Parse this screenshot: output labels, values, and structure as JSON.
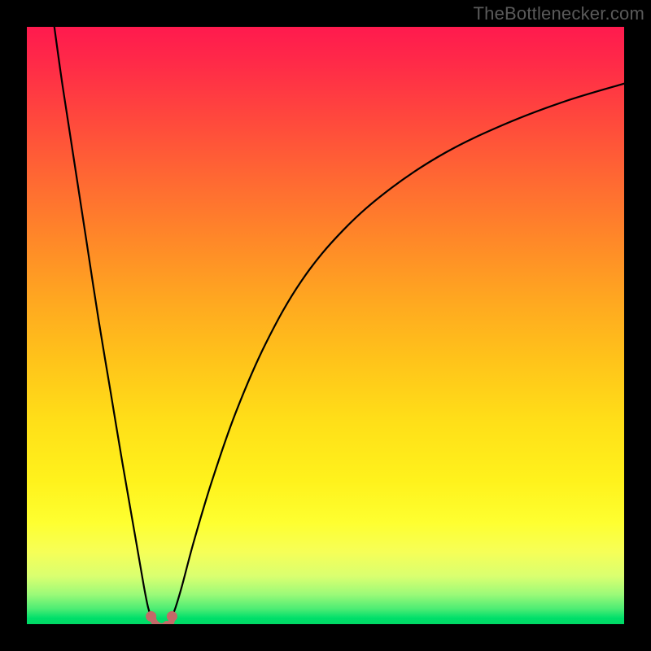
{
  "chart_data": {
    "type": "line",
    "title": "",
    "subtitle": "",
    "xlabel": "",
    "ylabel": "",
    "xlim": [
      0,
      100
    ],
    "ylim": [
      0,
      100
    ],
    "watermark": "TheBottlenecker.com",
    "gradient_stops": [
      {
        "pct": 0,
        "color": "#ff1a4e"
      },
      {
        "pct": 16,
        "color": "#ff4a3c"
      },
      {
        "pct": 36,
        "color": "#ff8928"
      },
      {
        "pct": 56,
        "color": "#ffc41a"
      },
      {
        "pct": 76,
        "color": "#fff21c"
      },
      {
        "pct": 88,
        "color": "#f6ff58"
      },
      {
        "pct": 95,
        "color": "#9cfa78"
      },
      {
        "pct": 99,
        "color": "#00df6a"
      },
      {
        "pct": 100,
        "color": "#00d965"
      }
    ],
    "series": [
      {
        "name": "left-branch",
        "x": [
          4.6,
          6.0,
          8.0,
          10.0,
          12.0,
          14.0,
          16.0,
          18.0,
          19.6,
          20.3,
          20.8
        ],
        "values": [
          100.0,
          90.0,
          77.0,
          64.0,
          51.0,
          39.0,
          27.0,
          15.5,
          6.3,
          2.8,
          1.3
        ]
      },
      {
        "name": "right-branch",
        "x": [
          24.3,
          24.9,
          26.0,
          28.0,
          31.0,
          35.0,
          40.0,
          46.0,
          53.0,
          61.0,
          70.0,
          80.0,
          90.0,
          100.0
        ],
        "values": [
          1.3,
          2.8,
          6.5,
          14.0,
          24.0,
          35.5,
          47.0,
          57.5,
          66.0,
          73.0,
          78.9,
          83.7,
          87.5,
          90.5
        ]
      }
    ],
    "valley_marker": {
      "left": {
        "x": 20.8,
        "y": 1.3
      },
      "right": {
        "x": 24.3,
        "y": 1.3
      },
      "bottoms": [
        {
          "x": 21.7,
          "y": 0.0
        },
        {
          "x": 23.4,
          "y": 0.0
        }
      ]
    },
    "colors": {
      "curve": "#000000",
      "marker": "#c46868"
    }
  }
}
